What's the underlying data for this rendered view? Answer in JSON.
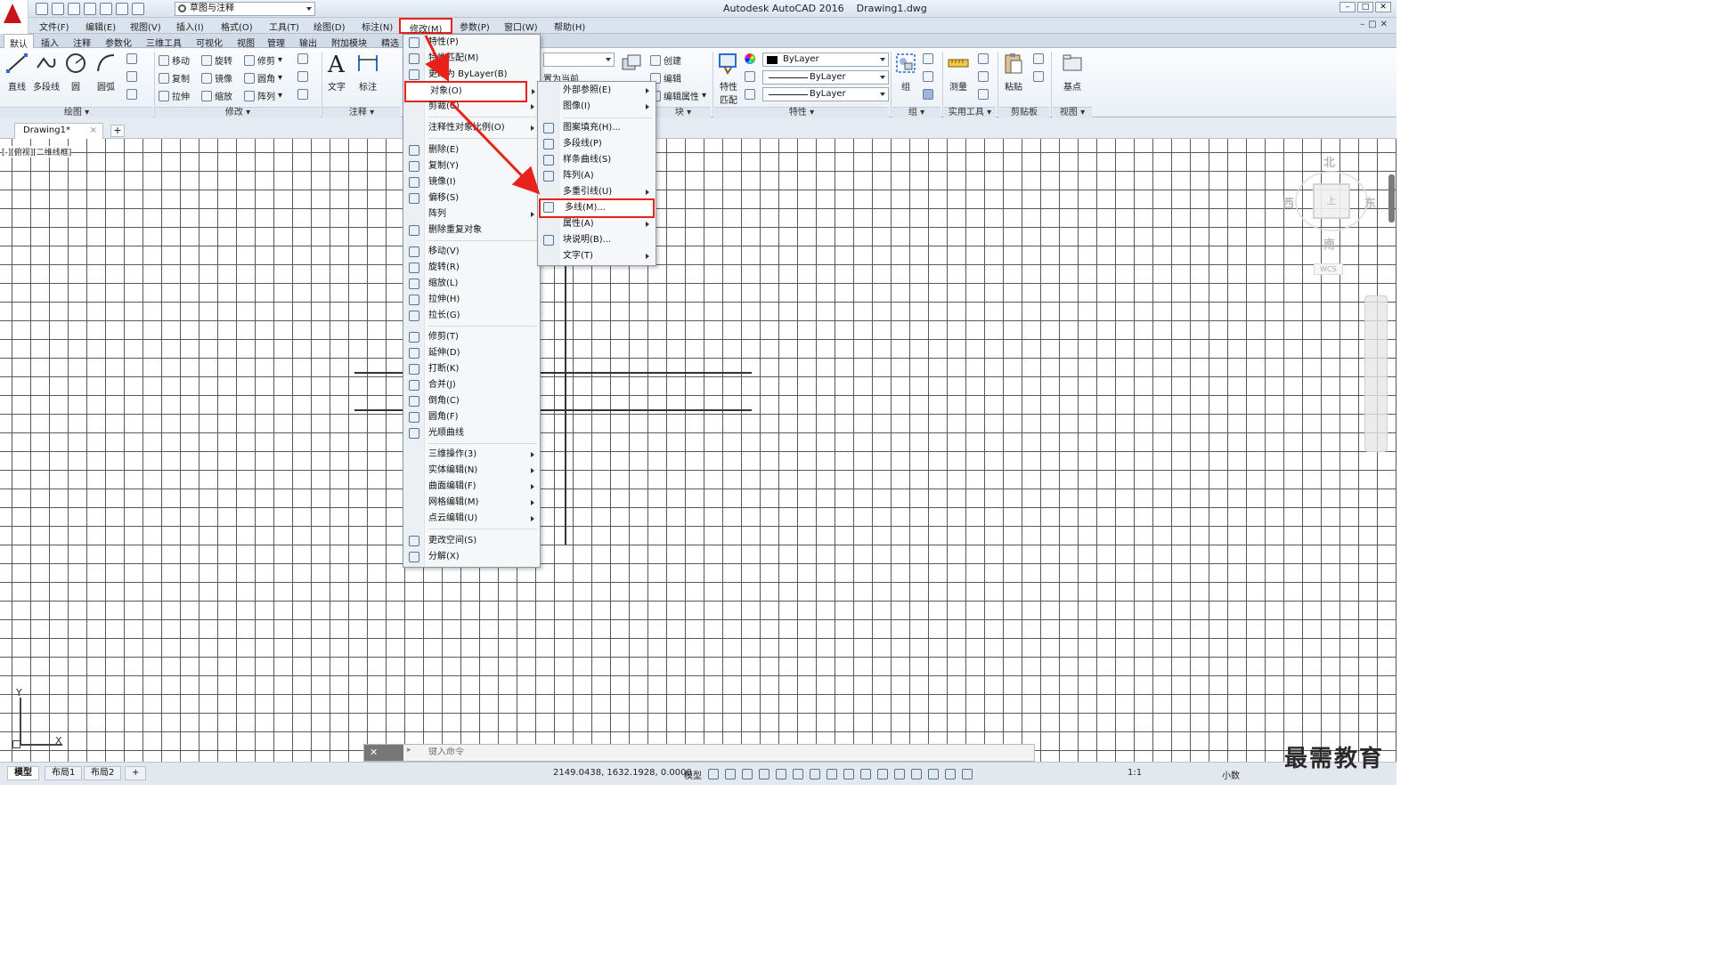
{
  "app": {
    "title": "Autodesk AutoCAD 2016",
    "document": "Drawing1.dwg",
    "workspace": "草图与注释"
  },
  "menubar": [
    "文件(F)",
    "编辑(E)",
    "视图(V)",
    "插入(I)",
    "格式(O)",
    "工具(T)",
    "绘图(D)",
    "标注(N)",
    "修改(M)",
    "参数(P)",
    "窗口(W)",
    "帮助(H)"
  ],
  "ribbon": {
    "tabs": [
      "默认",
      "插入",
      "注释",
      "参数化",
      "三维工具",
      "可视化",
      "视图",
      "管理",
      "输出",
      "附加模块",
      "精选"
    ],
    "draw": {
      "line": "直线",
      "polyline": "多段线",
      "circle": "圆",
      "arc": "圆弧",
      "label": "绘图"
    },
    "modify": {
      "move": "移动",
      "rotate": "旋转",
      "trim": "修剪",
      "copy": "复制",
      "mirror": "镜像",
      "fillet": "圆角",
      "stretch": "拉伸",
      "scale": "缩放",
      "array": "阵列",
      "label": "修改"
    },
    "annotation": {
      "text": "文字",
      "dimension": "标注",
      "label": "注释"
    },
    "layers": {
      "set_current": "置为当前"
    },
    "block": {
      "create": "创建",
      "edit": "编辑",
      "edit_attributes": "编辑属性",
      "label_tail": "块"
    },
    "properties": {
      "match": "特性",
      "match2": "匹配",
      "color": "ByLayer",
      "linetype": "ByLayer",
      "lineweight": "ByLayer",
      "label": "特性"
    },
    "group": {
      "group": "组",
      "label": "组"
    },
    "utilities": {
      "measure": "测量",
      "label": "实用工具"
    },
    "clipboard": {
      "paste": "粘贴",
      "label": "剪贴板"
    },
    "view": {
      "base": "基点",
      "label": "视图"
    }
  },
  "file_tab": {
    "name": "Drawing1*",
    "close": "×",
    "new": "+"
  },
  "viewport_label": "[-][俯视][二维线框]",
  "viewcube": {
    "north": "北",
    "south": "南",
    "east": "东",
    "west": "西",
    "face": "上",
    "wcs": "WCS"
  },
  "ucs": {
    "x": "X",
    "y": "Y"
  },
  "modify_menu": {
    "items": [
      "特性(P)",
      "特性匹配(M)",
      "更改为 ByLayer(B)",
      "对象(O)",
      "剪裁(C)",
      "注释性对象比例(O)",
      "删除(E)",
      "复制(Y)",
      "镜像(I)",
      "偏移(S)",
      "阵列",
      "删除重复对象",
      "移动(V)",
      "旋转(R)",
      "缩放(L)",
      "拉伸(H)",
      "拉长(G)",
      "修剪(T)",
      "延伸(D)",
      "打断(K)",
      "合并(J)",
      "倒角(C)",
      "圆角(F)",
      "光顺曲线",
      "三维操作(3)",
      "实体编辑(N)",
      "曲面编辑(F)",
      "网格编辑(M)",
      "点云编辑(U)",
      "更改空间(S)",
      "分解(X)"
    ]
  },
  "object_submenu": {
    "items": [
      "外部参照(E)",
      "图像(I)",
      "图案填充(H)...",
      "多段线(P)",
      "样条曲线(S)",
      "阵列(A)",
      "多重引线(U)",
      "多线(M)...",
      "属性(A)",
      "块说明(B)...",
      "文字(T)"
    ]
  },
  "command_line": {
    "placeholder": "键入命令",
    "buttons": "✕ ✎"
  },
  "status": {
    "layouts": [
      "模型",
      "布局1",
      "布局2"
    ],
    "add": "+",
    "coords": "2149.0438, 1632.1928, 0.0000",
    "model": "模型",
    "scale": "1:1",
    "units": "小数"
  },
  "watermark": "最需教育",
  "colors": {
    "highlight": "#e8221b",
    "accent": "#c8151b"
  }
}
